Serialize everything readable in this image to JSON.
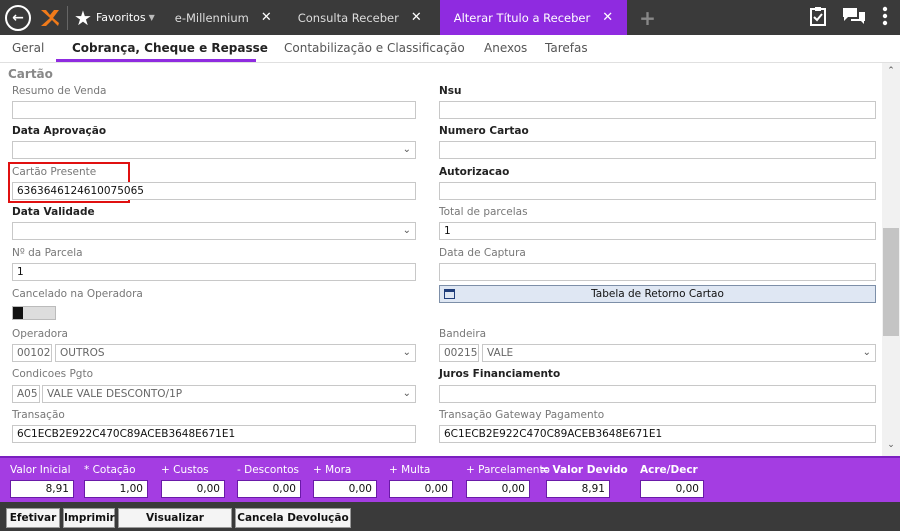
{
  "topbar": {
    "favorites_label": "Favoritos",
    "tabs": [
      {
        "label": "e-Millennium"
      },
      {
        "label": "Consulta Receber"
      },
      {
        "label": "Alterar Título a Receber"
      }
    ],
    "accent_color": "#8f2be0"
  },
  "subtabs": [
    {
      "label": "Geral"
    },
    {
      "label": "Cobrança, Cheque e Repasse"
    },
    {
      "label": "Contabilização e Classificação"
    },
    {
      "label": "Anexos"
    },
    {
      "label": "Tarefas"
    }
  ],
  "section": {
    "title": "Cartão"
  },
  "fields": {
    "resumo_venda": {
      "label": "Resumo de Venda",
      "value": ""
    },
    "nsu": {
      "label": "Nsu",
      "value": ""
    },
    "data_aprovacao": {
      "label": "Data Aprovação",
      "value": ""
    },
    "numero_cartao": {
      "label": "Numero Cartao",
      "value": ""
    },
    "cartao_presente": {
      "label": "Cartão Presente",
      "value": "6363646124610075065"
    },
    "autorizacao": {
      "label": "Autorizacao",
      "value": ""
    },
    "data_validade": {
      "label": "Data Validade",
      "value": ""
    },
    "total_parcelas": {
      "label": "Total de parcelas",
      "value": "1"
    },
    "num_parcela": {
      "label": "Nº da Parcela",
      "value": "1"
    },
    "data_captura": {
      "label": "Data de Captura",
      "value": ""
    },
    "cancelado_operadora": {
      "label": "Cancelado na Operadora"
    },
    "tabela_retorno": {
      "label": "Tabela de Retorno Cartao"
    },
    "operadora": {
      "label": "Operadora",
      "code": "00102",
      "value": "OUTROS"
    },
    "bandeira": {
      "label": "Bandeira",
      "code": "00215",
      "value": "VALE"
    },
    "condicoes_pgto": {
      "label": "Condicoes Pgto",
      "code": "A05",
      "value": "VALE VALE DESCONTO/1P"
    },
    "juros_financiamento": {
      "label": "Juros Financiamento",
      "value": ""
    },
    "transacao": {
      "label": "Transação",
      "value": "6C1ECB2E922C470C89ACEB3648E671E1"
    },
    "transacao_gateway": {
      "label": "Transação Gateway Pagamento",
      "value": "6C1ECB2E922C470C89ACEB3648E671E1"
    }
  },
  "totals": {
    "valor_inicial": {
      "label": "Valor Inicial",
      "value": "8,91"
    },
    "cotacao": {
      "label": "* Cotação",
      "value": "1,00"
    },
    "custos": {
      "label": "+ Custos",
      "value": "0,00"
    },
    "descontos": {
      "label": "- Descontos",
      "value": "0,00"
    },
    "mora": {
      "label": "+ Mora",
      "value": "0,00"
    },
    "multa": {
      "label": "+ Multa",
      "value": "0,00"
    },
    "parcelamento": {
      "label": "+ Parcelamento",
      "value": "0,00"
    },
    "valor_devido": {
      "label": "= Valor Devido",
      "value": "8,91"
    },
    "acre_decr": {
      "label": "Acre/Decr",
      "value": "0,00"
    }
  },
  "buttons": {
    "efetivar": "Efetivar",
    "imprimir": "Imprimir",
    "visualizar_auditoria": "Visualizar Auditoria",
    "cancela_devolucao": "Cancela Devolução"
  }
}
